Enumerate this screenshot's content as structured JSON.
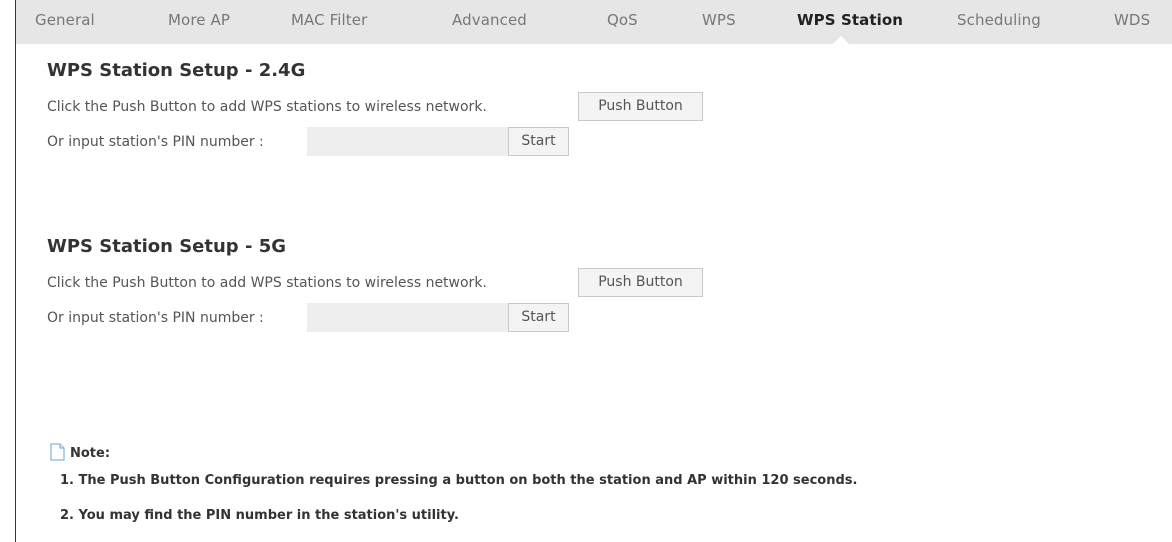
{
  "tabs": [
    {
      "label": "General",
      "active": false
    },
    {
      "label": "More AP",
      "active": false
    },
    {
      "label": "MAC Filter",
      "active": false
    },
    {
      "label": "Advanced",
      "active": false
    },
    {
      "label": "QoS",
      "active": false
    },
    {
      "label": "WPS",
      "active": false
    },
    {
      "label": "WPS Station",
      "active": true
    },
    {
      "label": "Scheduling",
      "active": false
    },
    {
      "label": "WDS",
      "active": false
    }
  ],
  "sections": [
    {
      "title": "WPS Station Setup - 2.4G",
      "push_text": "Click the Push Button to add WPS stations to wireless network.",
      "push_button": "Push Button",
      "pin_label": "Or input station's PIN number :",
      "pin_value": "",
      "start_button": "Start"
    },
    {
      "title": "WPS Station Setup - 5G",
      "push_text": "Click the Push Button to add WPS stations to wireless network.",
      "push_button": "Push Button",
      "pin_label": "Or input station's PIN number :",
      "pin_value": "",
      "start_button": "Start"
    }
  ],
  "note": {
    "label": "Note:",
    "lines": [
      "1. The Push Button Configuration requires pressing a button on both the station and AP within 120 seconds.",
      "2. You may find the PIN number in the station's utility."
    ]
  },
  "colors": {
    "tabbar_bg": "#e6e6e6",
    "active_tab": "#222222",
    "button_bg": "#f4f4f4"
  }
}
